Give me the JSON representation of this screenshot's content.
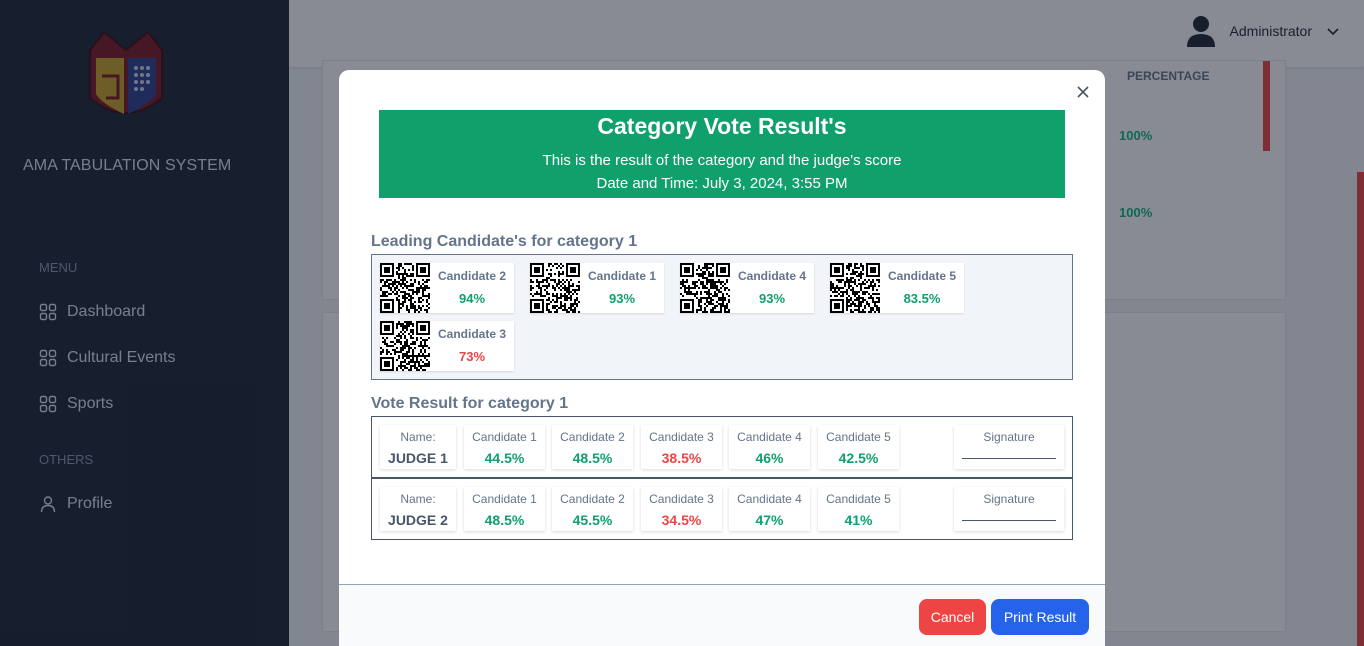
{
  "sidebar": {
    "brand": "AMA TABULATION SYSTEM",
    "menu_title": "MENU",
    "menu_items": [
      {
        "label": "Dashboard",
        "icon": "grid-icon"
      },
      {
        "label": "Cultural Events",
        "icon": "grid-icon"
      },
      {
        "label": "Sports",
        "icon": "grid-icon"
      }
    ],
    "others_title": "OTHERS",
    "others_items": [
      {
        "label": "Profile",
        "icon": "user-icon"
      }
    ]
  },
  "header": {
    "user_name": "Administrator",
    "avatar_icon": "user-avatar-icon",
    "dropdown_icon": "chevron-down-icon"
  },
  "background": {
    "column_header": "PERCENTAGE",
    "rows": [
      "100%",
      "100%"
    ]
  },
  "modal": {
    "title": "Category Vote Result's",
    "subtitle": "This is the result of the category and the judge's score",
    "datetime": "Date and Time: July 3, 2024, 3:55 PM",
    "leading_title": "Leading Candidate's for category 1",
    "leading": [
      {
        "name": "Candidate 2",
        "pct": "94%",
        "status": "green"
      },
      {
        "name": "Candidate 1",
        "pct": "93%",
        "status": "green"
      },
      {
        "name": "Candidate 4",
        "pct": "93%",
        "status": "green"
      },
      {
        "name": "Candidate 5",
        "pct": "83.5%",
        "status": "green"
      },
      {
        "name": "Candidate 3",
        "pct": "73%",
        "status": "red"
      }
    ],
    "vote_title": "Vote Result for category 1",
    "name_label": "Name:",
    "signature_label": "Signature",
    "judges": [
      {
        "name": "JUDGE 1",
        "scores": [
          {
            "candidate": "Candidate 1",
            "score": "44.5%",
            "status": "green"
          },
          {
            "candidate": "Candidate 2",
            "score": "48.5%",
            "status": "green"
          },
          {
            "candidate": "Candidate 3",
            "score": "38.5%",
            "status": "red"
          },
          {
            "candidate": "Candidate 4",
            "score": "46%",
            "status": "green"
          },
          {
            "candidate": "Candidate 5",
            "score": "42.5%",
            "status": "green"
          }
        ]
      },
      {
        "name": "JUDGE 2",
        "scores": [
          {
            "candidate": "Candidate 1",
            "score": "48.5%",
            "status": "green"
          },
          {
            "candidate": "Candidate 2",
            "score": "45.5%",
            "status": "green"
          },
          {
            "candidate": "Candidate 3",
            "score": "34.5%",
            "status": "red"
          },
          {
            "candidate": "Candidate 4",
            "score": "47%",
            "status": "green"
          },
          {
            "candidate": "Candidate 5",
            "score": "41%",
            "status": "green"
          }
        ]
      }
    ],
    "cancel_label": "Cancel",
    "print_label": "Print Result"
  },
  "colors": {
    "sidebar_bg": "#1c2434",
    "banner_bg": "#10a06b",
    "success": "#10a06b",
    "danger": "#ef4444",
    "primary": "#2563eb"
  }
}
